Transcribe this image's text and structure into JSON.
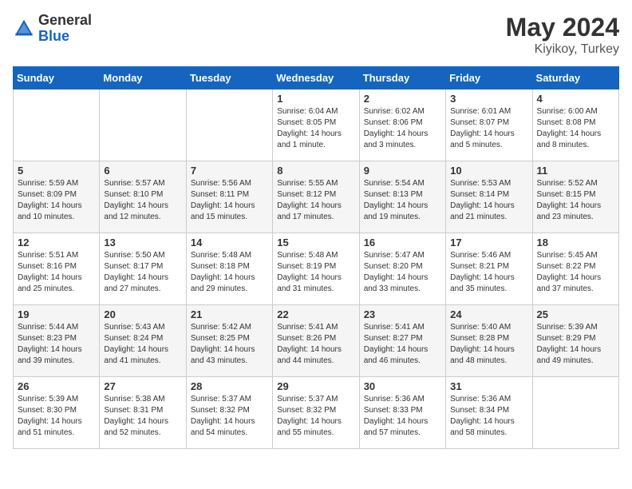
{
  "header": {
    "logo_general": "General",
    "logo_blue": "Blue",
    "month_year": "May 2024",
    "location": "Kiyikoy, Turkey"
  },
  "days_of_week": [
    "Sunday",
    "Monday",
    "Tuesday",
    "Wednesday",
    "Thursday",
    "Friday",
    "Saturday"
  ],
  "weeks": [
    [
      {
        "day": "",
        "content": ""
      },
      {
        "day": "",
        "content": ""
      },
      {
        "day": "",
        "content": ""
      },
      {
        "day": "1",
        "content": "Sunrise: 6:04 AM\nSunset: 8:05 PM\nDaylight: 14 hours\nand 1 minute."
      },
      {
        "day": "2",
        "content": "Sunrise: 6:02 AM\nSunset: 8:06 PM\nDaylight: 14 hours\nand 3 minutes."
      },
      {
        "day": "3",
        "content": "Sunrise: 6:01 AM\nSunset: 8:07 PM\nDaylight: 14 hours\nand 5 minutes."
      },
      {
        "day": "4",
        "content": "Sunrise: 6:00 AM\nSunset: 8:08 PM\nDaylight: 14 hours\nand 8 minutes."
      }
    ],
    [
      {
        "day": "5",
        "content": "Sunrise: 5:59 AM\nSunset: 8:09 PM\nDaylight: 14 hours\nand 10 minutes."
      },
      {
        "day": "6",
        "content": "Sunrise: 5:57 AM\nSunset: 8:10 PM\nDaylight: 14 hours\nand 12 minutes."
      },
      {
        "day": "7",
        "content": "Sunrise: 5:56 AM\nSunset: 8:11 PM\nDaylight: 14 hours\nand 15 minutes."
      },
      {
        "day": "8",
        "content": "Sunrise: 5:55 AM\nSunset: 8:12 PM\nDaylight: 14 hours\nand 17 minutes."
      },
      {
        "day": "9",
        "content": "Sunrise: 5:54 AM\nSunset: 8:13 PM\nDaylight: 14 hours\nand 19 minutes."
      },
      {
        "day": "10",
        "content": "Sunrise: 5:53 AM\nSunset: 8:14 PM\nDaylight: 14 hours\nand 21 minutes."
      },
      {
        "day": "11",
        "content": "Sunrise: 5:52 AM\nSunset: 8:15 PM\nDaylight: 14 hours\nand 23 minutes."
      }
    ],
    [
      {
        "day": "12",
        "content": "Sunrise: 5:51 AM\nSunset: 8:16 PM\nDaylight: 14 hours\nand 25 minutes."
      },
      {
        "day": "13",
        "content": "Sunrise: 5:50 AM\nSunset: 8:17 PM\nDaylight: 14 hours\nand 27 minutes."
      },
      {
        "day": "14",
        "content": "Sunrise: 5:48 AM\nSunset: 8:18 PM\nDaylight: 14 hours\nand 29 minutes."
      },
      {
        "day": "15",
        "content": "Sunrise: 5:48 AM\nSunset: 8:19 PM\nDaylight: 14 hours\nand 31 minutes."
      },
      {
        "day": "16",
        "content": "Sunrise: 5:47 AM\nSunset: 8:20 PM\nDaylight: 14 hours\nand 33 minutes."
      },
      {
        "day": "17",
        "content": "Sunrise: 5:46 AM\nSunset: 8:21 PM\nDaylight: 14 hours\nand 35 minutes."
      },
      {
        "day": "18",
        "content": "Sunrise: 5:45 AM\nSunset: 8:22 PM\nDaylight: 14 hours\nand 37 minutes."
      }
    ],
    [
      {
        "day": "19",
        "content": "Sunrise: 5:44 AM\nSunset: 8:23 PM\nDaylight: 14 hours\nand 39 minutes."
      },
      {
        "day": "20",
        "content": "Sunrise: 5:43 AM\nSunset: 8:24 PM\nDaylight: 14 hours\nand 41 minutes."
      },
      {
        "day": "21",
        "content": "Sunrise: 5:42 AM\nSunset: 8:25 PM\nDaylight: 14 hours\nand 43 minutes."
      },
      {
        "day": "22",
        "content": "Sunrise: 5:41 AM\nSunset: 8:26 PM\nDaylight: 14 hours\nand 44 minutes."
      },
      {
        "day": "23",
        "content": "Sunrise: 5:41 AM\nSunset: 8:27 PM\nDaylight: 14 hours\nand 46 minutes."
      },
      {
        "day": "24",
        "content": "Sunrise: 5:40 AM\nSunset: 8:28 PM\nDaylight: 14 hours\nand 48 minutes."
      },
      {
        "day": "25",
        "content": "Sunrise: 5:39 AM\nSunset: 8:29 PM\nDaylight: 14 hours\nand 49 minutes."
      }
    ],
    [
      {
        "day": "26",
        "content": "Sunrise: 5:39 AM\nSunset: 8:30 PM\nDaylight: 14 hours\nand 51 minutes."
      },
      {
        "day": "27",
        "content": "Sunrise: 5:38 AM\nSunset: 8:31 PM\nDaylight: 14 hours\nand 52 minutes."
      },
      {
        "day": "28",
        "content": "Sunrise: 5:37 AM\nSunset: 8:32 PM\nDaylight: 14 hours\nand 54 minutes."
      },
      {
        "day": "29",
        "content": "Sunrise: 5:37 AM\nSunset: 8:32 PM\nDaylight: 14 hours\nand 55 minutes."
      },
      {
        "day": "30",
        "content": "Sunrise: 5:36 AM\nSunset: 8:33 PM\nDaylight: 14 hours\nand 57 minutes."
      },
      {
        "day": "31",
        "content": "Sunrise: 5:36 AM\nSunset: 8:34 PM\nDaylight: 14 hours\nand 58 minutes."
      },
      {
        "day": "",
        "content": ""
      }
    ]
  ]
}
